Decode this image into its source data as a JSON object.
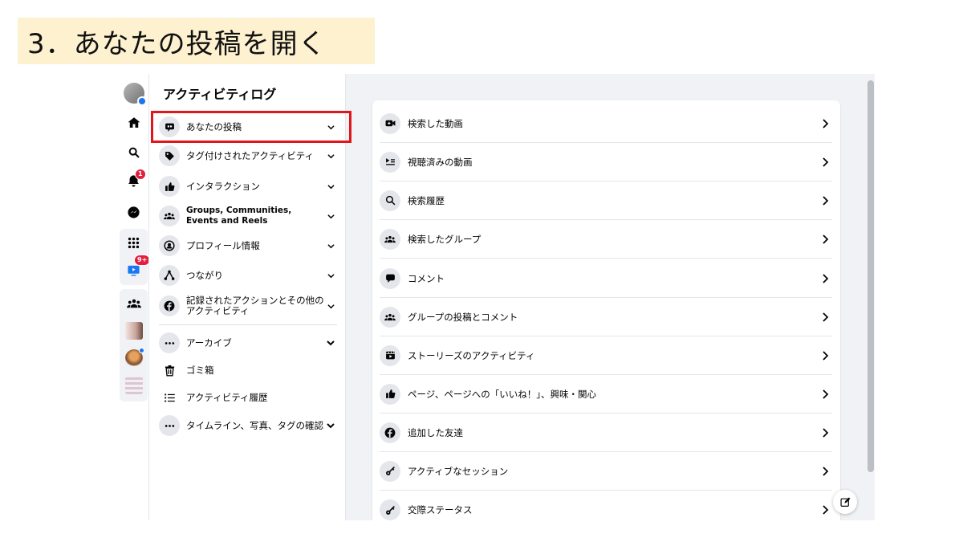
{
  "slide": {
    "title": "3．あなたの投稿を開く"
  },
  "rail": {
    "notifications_badge": "1",
    "watch_badge": "9+"
  },
  "nav": {
    "title": "アクティビティログ",
    "items": [
      {
        "label": "あなたの投稿",
        "icon": "speech-bubble-icon"
      },
      {
        "label": "タグ付けされたアクティビティ",
        "icon": "tag-icon"
      },
      {
        "label": "インタラクション",
        "icon": "thumbs-up-icon"
      },
      {
        "label": "Groups, Communities, Events and Reels",
        "icon": "people-icon"
      },
      {
        "label": "プロフィール情報",
        "icon": "profile-icon"
      },
      {
        "label": "つながり",
        "icon": "connections-icon"
      },
      {
        "label": "記録されたアクションとその他のアクティビティ",
        "icon": "facebook-icon"
      }
    ],
    "secondary": [
      {
        "label": "アーカイブ",
        "icon": "ellipsis-icon"
      },
      {
        "label": "ゴミ箱",
        "icon": "trash-icon"
      },
      {
        "label": "アクティビティ履歴",
        "icon": "list-icon"
      },
      {
        "label": "タイムライン、写真、タグの確認",
        "icon": "ellipsis-icon"
      }
    ]
  },
  "content": {
    "rows": [
      {
        "label": "検索した動画",
        "icon": "video-icon"
      },
      {
        "label": "視聴済みの動画",
        "icon": "playlist-icon"
      },
      {
        "label": "検索履歴",
        "icon": "search-icon"
      },
      {
        "label": "検索したグループ",
        "icon": "group-icon"
      },
      {
        "label": "コメント",
        "icon": "comment-icon"
      },
      {
        "label": "グループの投稿とコメント",
        "icon": "group-icon"
      },
      {
        "label": "ストーリーズのアクティビティ",
        "icon": "film-icon"
      },
      {
        "label": "ページ、ページへの「いいね！」、興味・関心",
        "icon": "thumbs-up-icon"
      },
      {
        "label": "追加した友達",
        "icon": "facebook-icon"
      },
      {
        "label": "アクティブなセッション",
        "icon": "key-icon"
      },
      {
        "label": "交際ステータス",
        "icon": "key-icon"
      }
    ]
  }
}
